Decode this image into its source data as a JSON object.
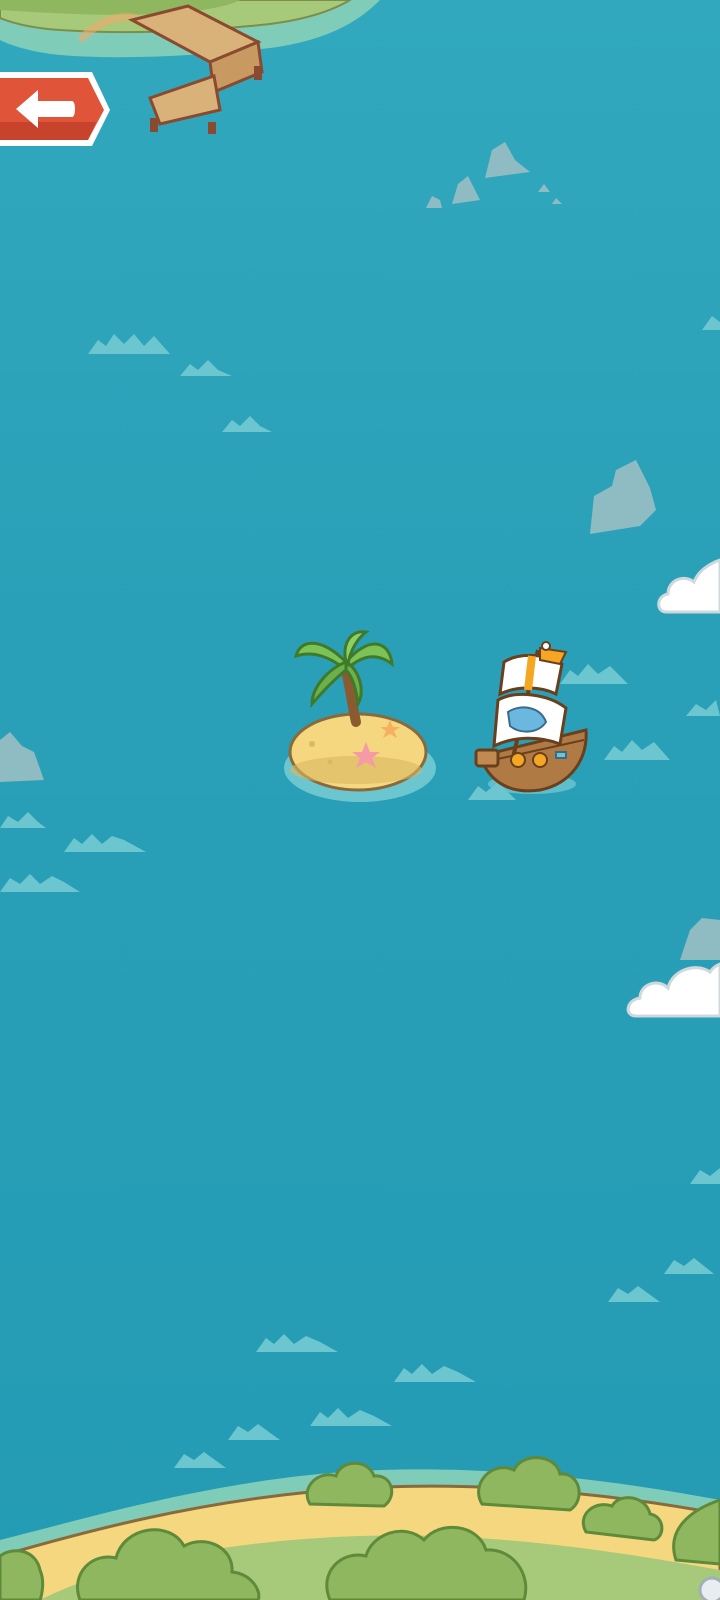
{
  "scene": {
    "name": "sea-map",
    "colors": {
      "sea": "#2aa0b8",
      "wave": "#6cc6cf",
      "sand": "#f4d77e",
      "sand_dark": "#d8b862",
      "grass": "#a6c97a",
      "bush": "#8fb760",
      "bush_dark": "#6f9a48",
      "rock": "#9fbcc2",
      "cloud": "#ffffff",
      "back_button": "#e0553a",
      "sail_stripe": "#f5a623",
      "hull": "#b07a44"
    }
  },
  "back_button": {
    "icon": "back-arrow-icon"
  },
  "sprites": {
    "ship": "pirate-ship",
    "island": "palm-island",
    "dock": "wooden-dock"
  }
}
